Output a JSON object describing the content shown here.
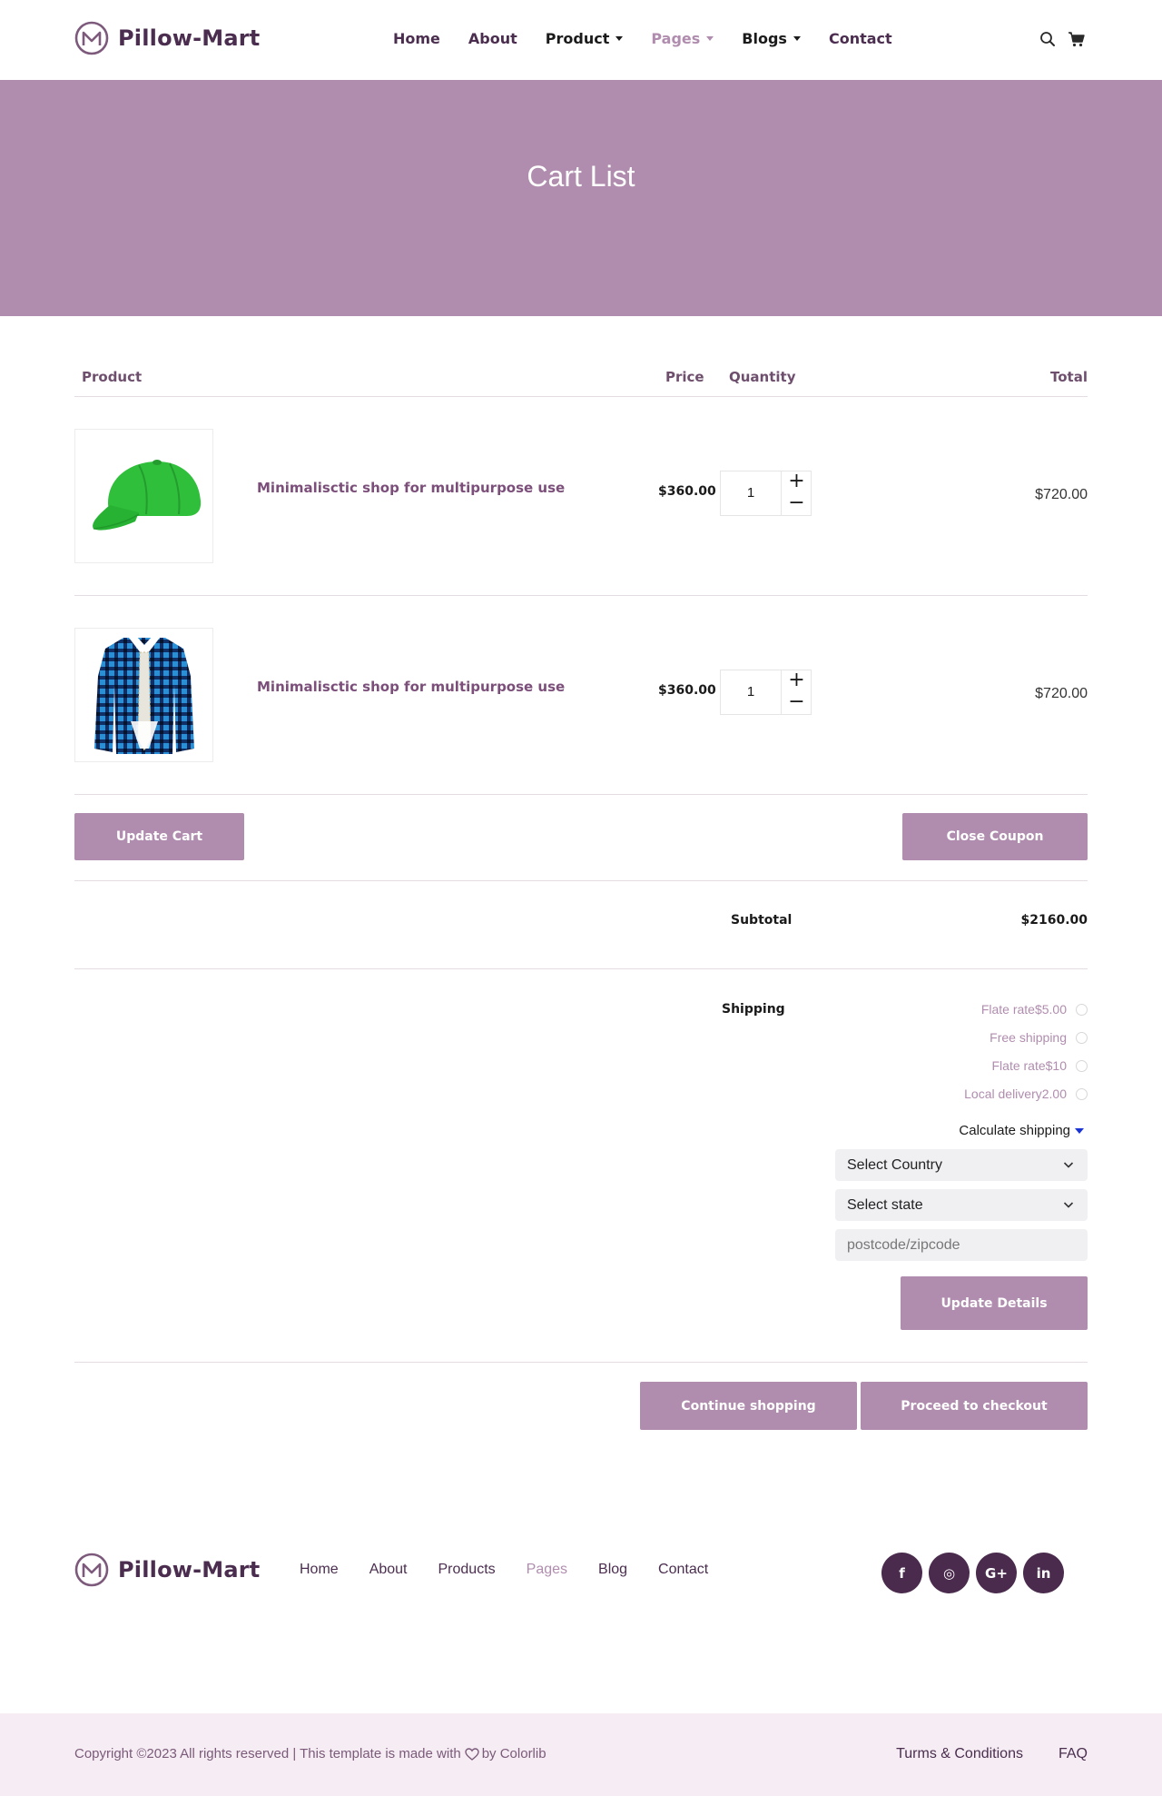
{
  "brand": {
    "name": "Pillow-Mart"
  },
  "nav": {
    "items": [
      {
        "label": "Home"
      },
      {
        "label": "About"
      },
      {
        "label": "Product"
      },
      {
        "label": "Pages"
      },
      {
        "label": "Blogs"
      },
      {
        "label": "Contact"
      }
    ]
  },
  "header_icons": [
    "search-icon",
    "cart-icon"
  ],
  "banner": {
    "title": "Cart List"
  },
  "cart": {
    "headers": {
      "product": "Product",
      "price": "Price",
      "quantity": "Quantity",
      "total": "Total"
    },
    "items": [
      {
        "name": "Minimalisctic shop for multipurpose use",
        "image": "green-cap-image",
        "price": "$360.00",
        "quantity": "1",
        "total": "$720.00"
      },
      {
        "name": "Minimalisctic shop for multipurpose use",
        "image": "plaid-shirt-image",
        "price": "$360.00",
        "quantity": "1",
        "total": "$720.00"
      }
    ],
    "qty_plus": "+",
    "qty_minus": "−",
    "update_cart_label": "Update Cart",
    "close_coupon_label": "Close Coupon",
    "subtotal_label": "Subtotal",
    "subtotal_value": "$2160.00"
  },
  "shipping": {
    "label": "Shipping",
    "options": [
      {
        "label": "Flate rate$5.00"
      },
      {
        "label": "Free shipping"
      },
      {
        "label": "Flate rate$10"
      },
      {
        "label": "Local delivery2.00"
      }
    ],
    "calculate_label": "Calculate shipping",
    "country_select": "Select Country",
    "state_select": "Select state",
    "postcode_placeholder": "postcode/zipcode",
    "update_details_label": "Update Details"
  },
  "actions": {
    "continue_label": "Continue shopping",
    "checkout_label": "Proceed to checkout"
  },
  "footer": {
    "nav": [
      {
        "label": "Home"
      },
      {
        "label": "About"
      },
      {
        "label": "Products"
      },
      {
        "label": "Pages"
      },
      {
        "label": "Blog"
      },
      {
        "label": "Contact"
      }
    ],
    "socials": [
      {
        "icon": "facebook-icon",
        "glyph": "f"
      },
      {
        "icon": "instagram-icon",
        "glyph": "◎"
      },
      {
        "icon": "google-plus-icon",
        "glyph": "G+"
      },
      {
        "icon": "linkedin-icon",
        "glyph": "in"
      }
    ],
    "copyright_prefix": "Copyright ©2023 All rights reserved | This template is made with",
    "copyright_suffix": "by Colorlib",
    "bottom_links": [
      {
        "label": "Turms & Conditions"
      },
      {
        "label": "FAQ"
      }
    ]
  },
  "colors": {
    "accent": "#b08dae",
    "brand_dark": "#4b2e4f",
    "footer_bg": "#f5edf3"
  }
}
